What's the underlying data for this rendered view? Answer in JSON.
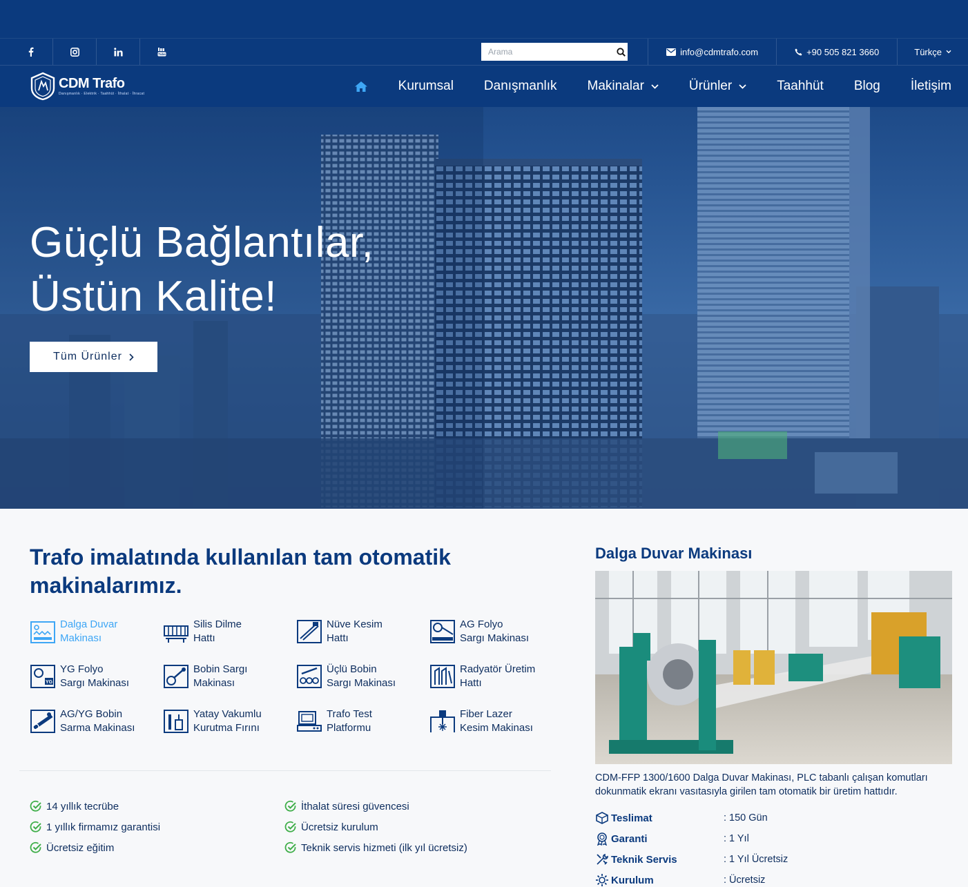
{
  "header": {
    "social": [
      {
        "icon": "facebook-icon",
        "glyph": "f"
      },
      {
        "icon": "instagram-icon",
        "glyph": "◙"
      },
      {
        "icon": "linkedin-icon",
        "glyph": "in"
      },
      {
        "icon": "youtube-icon",
        "glyph": "▶"
      }
    ],
    "search_placeholder": "Arama",
    "email": "info@cdmtrafo.com",
    "phone": "+90 505 821 3660",
    "language": "Türkçe"
  },
  "nav": {
    "logo_text": "CDM Trafo",
    "logo_sub": "Danışmanlık · Elektrik · Taahhüt · İthalat · İhracat",
    "items": [
      {
        "label": "Kurumsal",
        "dropdown": false
      },
      {
        "label": "Danışmanlık",
        "dropdown": false
      },
      {
        "label": "Makinalar",
        "dropdown": true
      },
      {
        "label": "Ürünler",
        "dropdown": true
      },
      {
        "label": "Taahhüt",
        "dropdown": false
      },
      {
        "label": "Blog",
        "dropdown": false
      },
      {
        "label": "İletişim",
        "dropdown": false
      }
    ]
  },
  "hero": {
    "title_line1": "Güçlü Bağlantılar,",
    "title_line2": "Üstün Kalite!",
    "button_label": "Tüm Ürünler"
  },
  "machines_section": {
    "title": "Trafo imalatında kullanılan tam otomatik makinalarımız.",
    "items": [
      {
        "line1": "Dalga Duvar",
        "line2": "Makinası",
        "active": true
      },
      {
        "line1": "Silis Dilme",
        "line2": "Hattı"
      },
      {
        "line1": "Nüve Kesim",
        "line2": "Hattı"
      },
      {
        "line1": "AG Folyo",
        "line2": "Sargı Makinası"
      },
      {
        "line1": "YG Folyo",
        "line2": "Sargı Makinası"
      },
      {
        "line1": "Bobin Sargı",
        "line2": "Makinası"
      },
      {
        "line1": "Üçlü Bobin",
        "line2": "Sargı Makinası"
      },
      {
        "line1": "Radyatör Üretim",
        "line2": "Hattı"
      },
      {
        "line1": "AG/YG Bobin",
        "line2": "Sarma Makinası"
      },
      {
        "line1": "Yatay Vakumlu",
        "line2": "Kurutma Fırını"
      },
      {
        "line1": "Trafo Test",
        "line2": "Platformu"
      },
      {
        "line1": "Fiber Lazer",
        "line2": "Kesim Makinası"
      }
    ]
  },
  "features": [
    "14 yıllık tecrübe",
    "İthalat süresi güvencesi",
    "1 yıllık firmamız garantisi",
    "Ücretsiz kurulum",
    "Ücretsiz eğitim",
    "Teknik servis hizmeti (ilk yıl ücretsiz)"
  ],
  "detail": {
    "title": "Dalga Duvar Makinası",
    "description": "CDM-FFP 1300/1600 Dalga Duvar Makinası, PLC tabanlı çalışan komutları dokunmatik ekranı vasıtasıyla girilen tam otomatik bir üretim hattıdır.",
    "specs": [
      {
        "icon": "box-icon",
        "label": "Teslimat",
        "value": ": 150 Gün"
      },
      {
        "icon": "award-icon",
        "label": "Garanti",
        "value": ": 1 Yıl"
      },
      {
        "icon": "tools-icon",
        "label": "Teknik Servis",
        "value": ": 1 Yıl Ücretsiz"
      },
      {
        "icon": "gear-icon",
        "label": "Kurulum",
        "value": ": Ücretsiz"
      }
    ]
  },
  "colors": {
    "navy": "#0b3a7e",
    "accent_blue": "#3ea6f5",
    "check_green": "#3fae49"
  }
}
